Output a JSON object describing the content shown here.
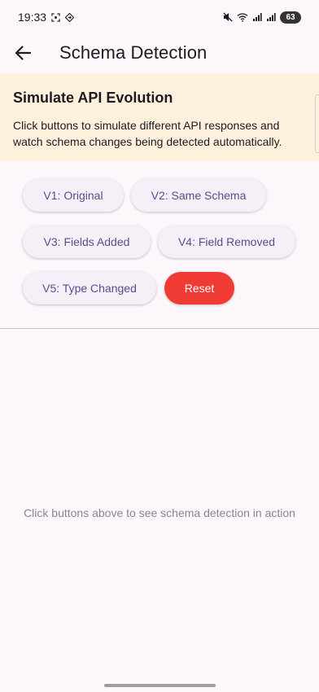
{
  "status_bar": {
    "time": "19:33",
    "battery": "63"
  },
  "app_bar": {
    "title": "Schema Detection",
    "back_icon": "arrow-left-icon"
  },
  "info_card": {
    "title": "Simulate API Evolution",
    "description": "Click buttons to simulate different API responses and watch schema changes being detected automatically."
  },
  "buttons": {
    "v1": "V1: Original",
    "v2": "V2: Same Schema",
    "v3": "V3: Fields Added",
    "v4": "V4: Field Removed",
    "v5": "V5: Type Changed",
    "reset": "Reset"
  },
  "empty_state": {
    "message": "Click buttons above to see schema detection in action"
  },
  "colors": {
    "background": "#fdf6fb",
    "info_card": "#fdf1de",
    "button_text": "#5e4a8c",
    "reset": "#ef3b34"
  }
}
